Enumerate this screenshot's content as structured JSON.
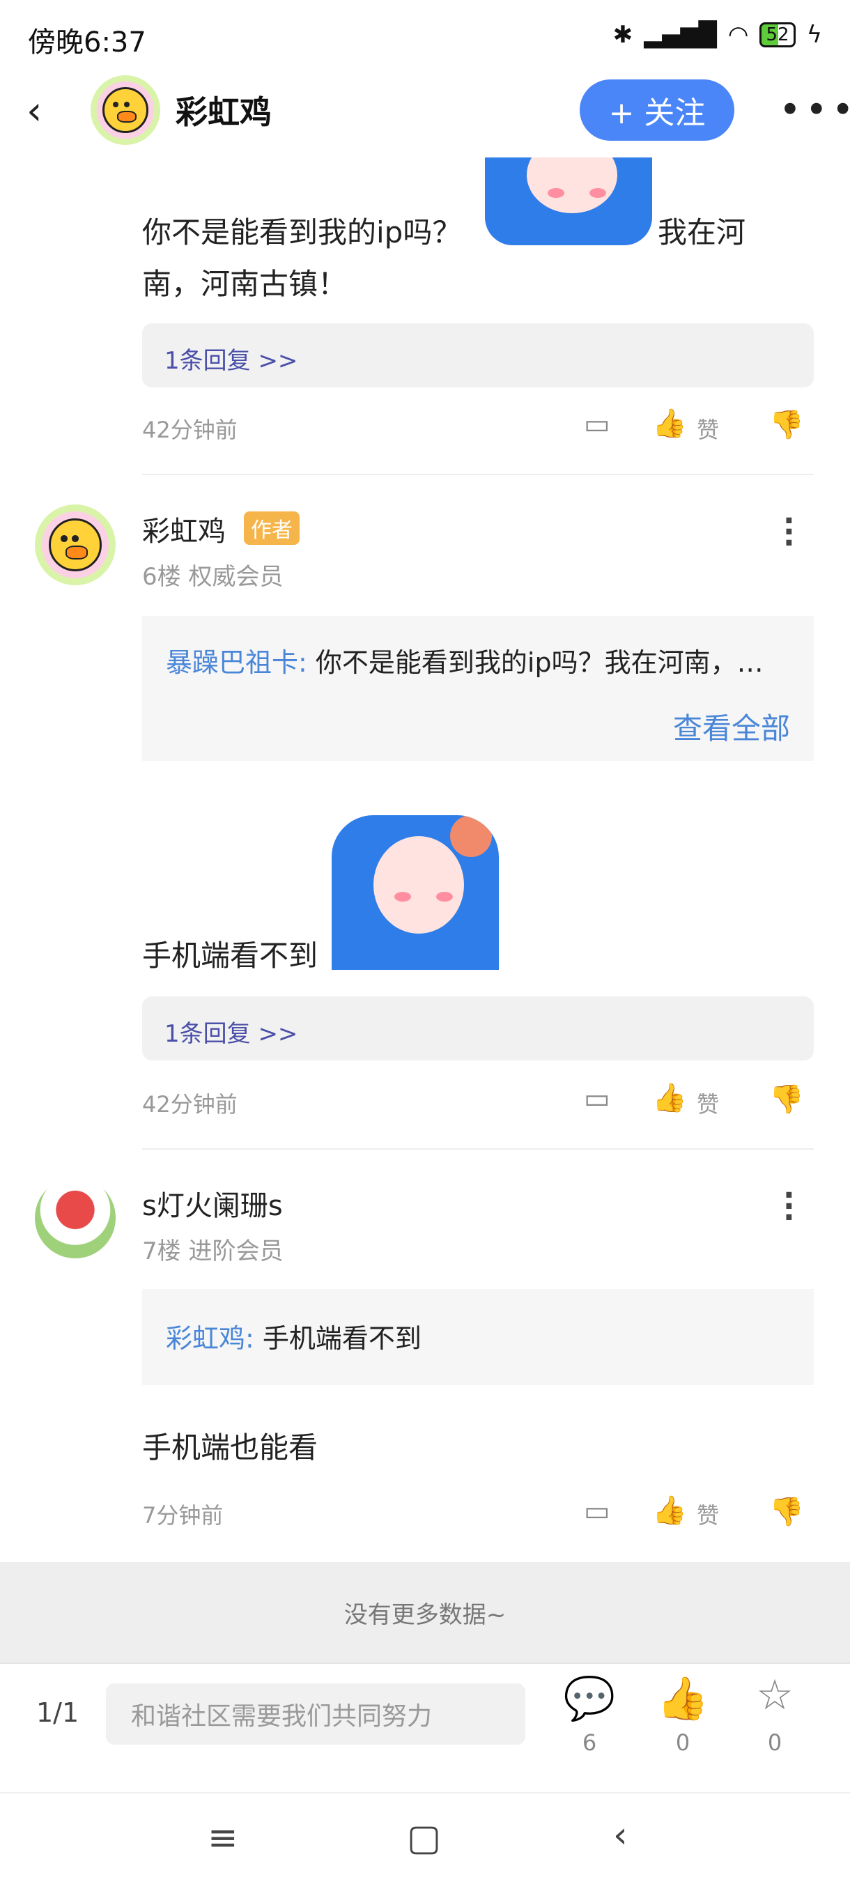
{
  "status": {
    "time": "傍晚6:37",
    "battery": "52"
  },
  "header": {
    "title": "彩虹鸡",
    "follow_label": "+ 关注"
  },
  "comments": [
    {
      "text_before": "你不是能看到我的ip吗？",
      "text_after": "我在河",
      "text_line2": "南，河南古镇！",
      "replies": "1条回复 >>",
      "time": "42分钟前",
      "like_label": "赞"
    },
    {
      "username": "彩虹鸡",
      "badge": "作者",
      "floor": "6楼 权威会员",
      "quote_name": "暴躁巴祖卡:",
      "quote_text": " 你不是能看到我的ip吗？我在河南，…",
      "view_all": "查看全部",
      "text": "手机端看不到",
      "replies": "1条回复 >>",
      "time": "42分钟前",
      "like_label": "赞"
    },
    {
      "username": "s灯火阑珊s",
      "floor": "7楼 进阶会员",
      "quote_name": "彩虹鸡:",
      "quote_text": " 手机端看不到",
      "text": "手机端也能看",
      "time": "7分钟前",
      "like_label": "赞"
    }
  ],
  "no_more": "没有更多数据~",
  "bottom": {
    "page": "1/1",
    "placeholder": "和谐社区需要我们共同努力",
    "comment_count": "6",
    "like_count": "0",
    "star_count": "0"
  },
  "icons": [
    "back-icon",
    "more-horizontal-icon",
    "comment-icon",
    "thumbs-up-icon",
    "thumbs-down-icon",
    "more-vertical-icon",
    "star-icon",
    "menu-icon",
    "home-icon",
    "nav-back-icon"
  ]
}
